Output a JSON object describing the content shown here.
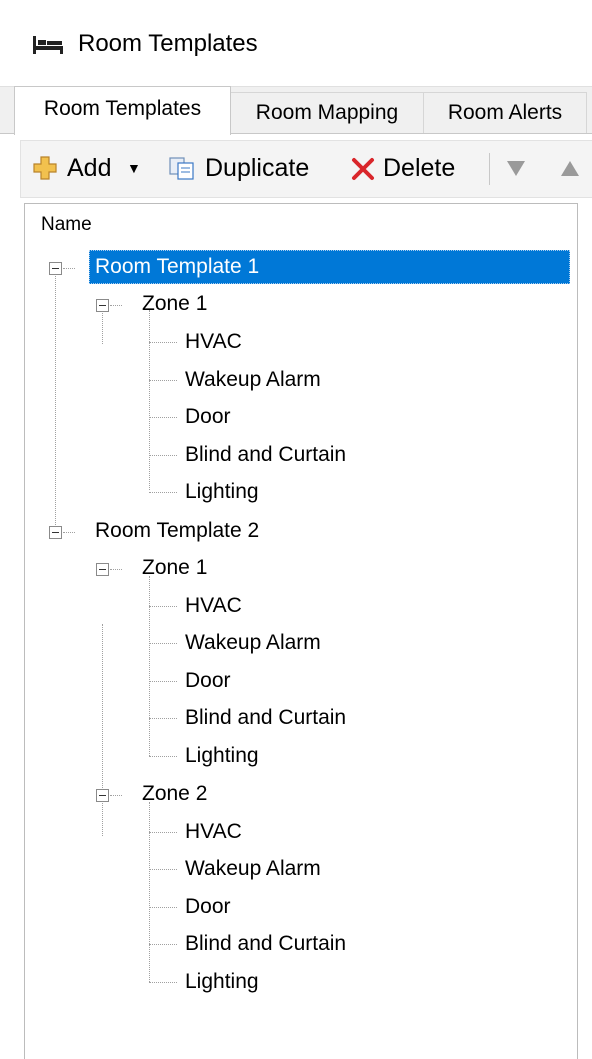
{
  "window": {
    "title": "Room Templates",
    "icon": "bed-icon"
  },
  "tabs": [
    {
      "label": "Room Templates",
      "active": true
    },
    {
      "label": "Room Mapping",
      "active": false
    },
    {
      "label": "Room Alerts",
      "active": false
    }
  ],
  "toolbar": {
    "add_label": "Add",
    "duplicate_label": "Duplicate",
    "delete_label": "Delete",
    "move_down_icon": "triangle-down-icon",
    "move_up_icon": "triangle-up-icon"
  },
  "tree": {
    "column_header": "Name",
    "selected": "Room Template 1",
    "templates": [
      {
        "label": "Room Template 1",
        "zones": [
          {
            "label": "Zone 1",
            "items": [
              "HVAC",
              "Wakeup Alarm",
              "Door",
              "Blind and Curtain",
              "Lighting"
            ]
          }
        ]
      },
      {
        "label": "Room Template 2",
        "zones": [
          {
            "label": "Zone 1",
            "items": [
              "HVAC",
              "Wakeup Alarm",
              "Door",
              "Blind and Curtain",
              "Lighting"
            ]
          },
          {
            "label": "Zone 2",
            "items": [
              "HVAC",
              "Wakeup Alarm",
              "Door",
              "Blind and Curtain",
              "Lighting"
            ]
          }
        ]
      }
    ]
  },
  "colors": {
    "selection": "#0078d7",
    "delete_red": "#d9262b",
    "add_gold": "#e0a63a"
  }
}
